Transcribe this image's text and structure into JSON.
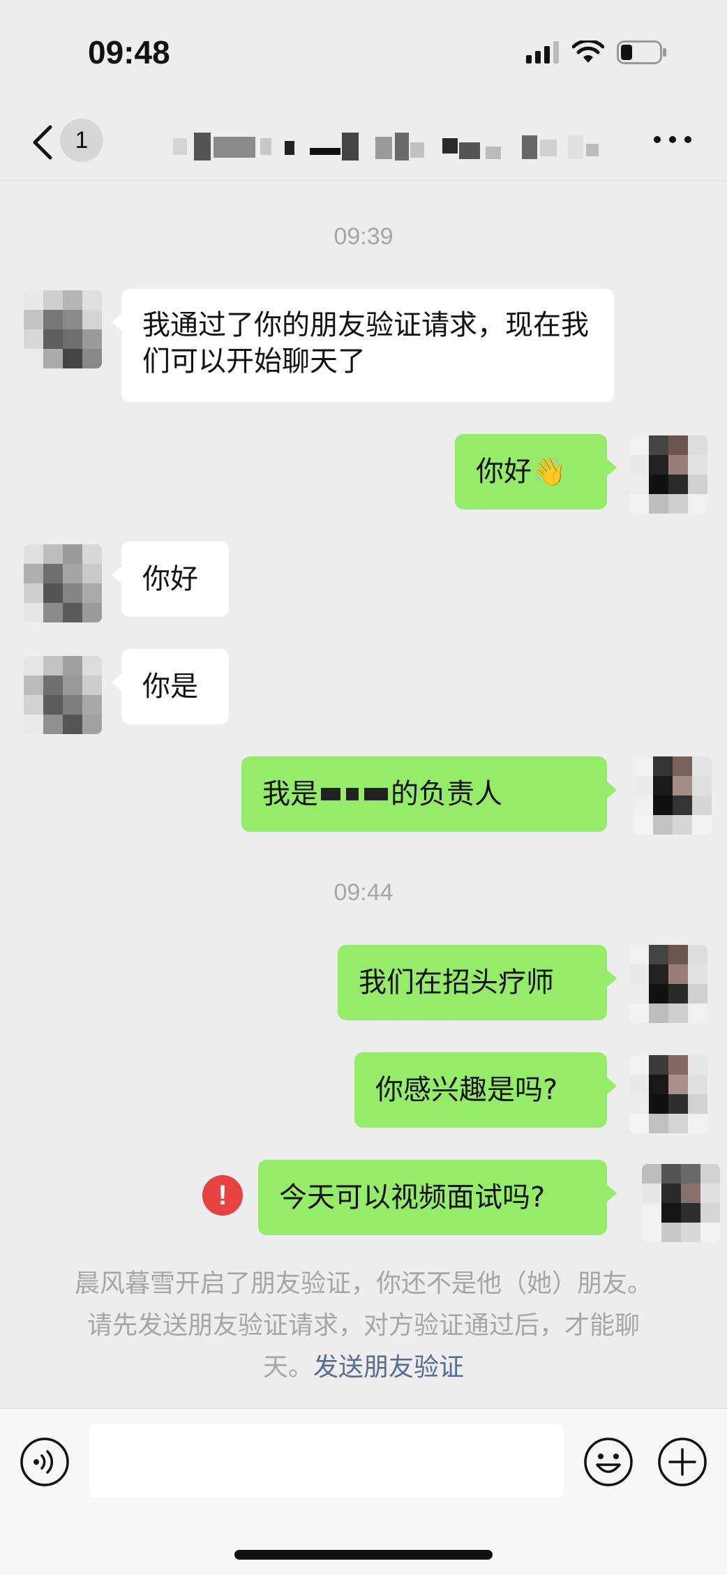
{
  "status_bar": {
    "time": "09:48"
  },
  "nav": {
    "back_count": "1"
  },
  "messages": [
    {
      "time": "09:39"
    },
    {
      "dir": "in",
      "text": "我通过了你的朋友验证请求，现在我们可以开始聊天了"
    },
    {
      "dir": "out",
      "text": "你好👋"
    },
    {
      "dir": "in",
      "text": "你好"
    },
    {
      "dir": "in",
      "text": "你是"
    },
    {
      "dir": "out",
      "text_start": "我是",
      "text_end": "的负责人"
    },
    {
      "time": "09:44"
    },
    {
      "dir": "out",
      "text": "我们在招头疗师"
    },
    {
      "dir": "out",
      "text": "你感兴趣是吗?"
    },
    {
      "dir": "out",
      "text": "今天可以视频面试吗?",
      "failed": true
    }
  ],
  "system_note": {
    "text": "晨风暮雪开启了朋友验证，你还不是他（她）朋友。请先发送朋友验证请求，对方验证通过后，才能聊天。",
    "link": "发送朋友验证"
  },
  "input": {
    "value": "",
    "placeholder": ""
  },
  "icons": {
    "back": "chevron-left-icon",
    "more": "more-dots-icon",
    "voice": "voice-icon",
    "emoji": "emoji-icon",
    "plus": "plus-icon",
    "error": "error-icon"
  },
  "colors": {
    "outgoing_bubble": "#95ec69",
    "incoming_bubble": "#ffffff",
    "error": "#e64340",
    "link": "#576b95"
  }
}
